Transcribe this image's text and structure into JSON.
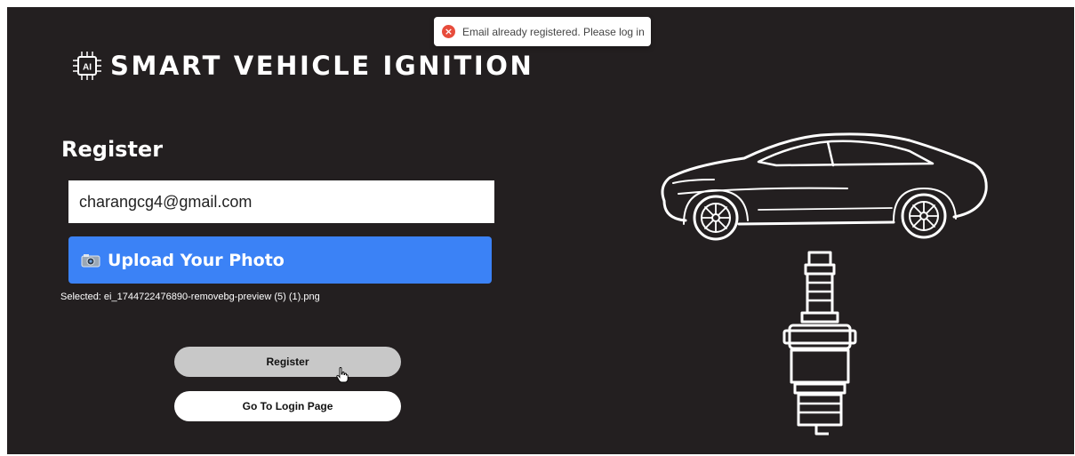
{
  "toast": {
    "message": "Email already registered. Please log in",
    "icon": "error-icon",
    "color": "#e74c3c"
  },
  "brand": {
    "logo_text": "AI",
    "title": "SMART VEHICLE IGNITION"
  },
  "form": {
    "title": "Register",
    "email_value": "charangcg4@gmail.com",
    "upload_label": "Upload Your Photo",
    "selected_file": "Selected: ei_1744722476890-removebg-preview (5) (1).png",
    "register_label": "Register",
    "login_label": "Go To Login Page"
  },
  "colors": {
    "background": "#231f20",
    "accent": "#3b82f6",
    "button_gray": "#c8c8c8"
  },
  "illustrations": {
    "car": "car-outline-illustration",
    "plug": "spark-plug-illustration"
  }
}
